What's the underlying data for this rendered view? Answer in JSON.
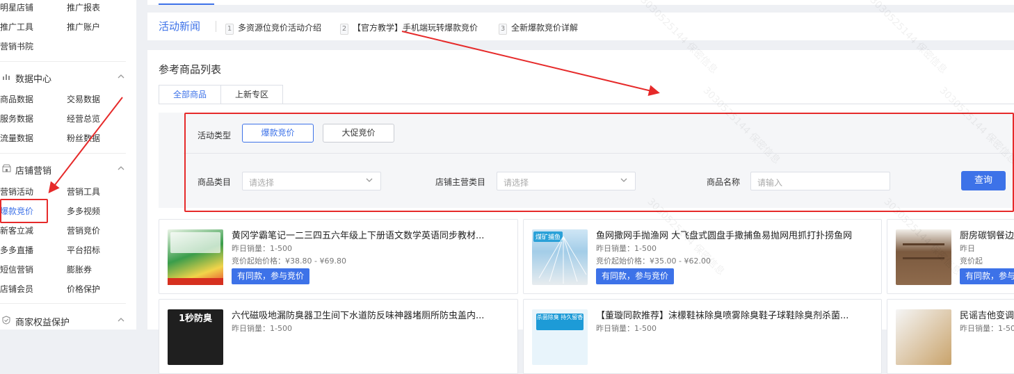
{
  "sidebar": {
    "top_links": [
      "明星店铺",
      "推广报表",
      "推广工具",
      "推广账户",
      "营销书院"
    ],
    "data_center": {
      "title": "数据中心",
      "links": [
        "商品数据",
        "交易数据",
        "服务数据",
        "经营总览",
        "流量数据",
        "粉丝数据"
      ]
    },
    "shop_marketing": {
      "title": "店铺营销",
      "links": [
        "营销活动",
        "营销工具",
        "爆款竞价",
        "多多视频",
        "新客立减",
        "营销竞价",
        "多多直播",
        "平台招标",
        "短信营销",
        "膨胀券",
        "店铺会员",
        "价格保护"
      ]
    },
    "merchant_rights": {
      "title": "商家权益保护"
    }
  },
  "news": {
    "label": "活动新闻",
    "items": [
      {
        "num": "1",
        "text": "多资源位竞价活动介绍"
      },
      {
        "num": "2",
        "text": "【官方教学】手机端玩转爆款竞价"
      },
      {
        "num": "3",
        "text": "全新爆款竞价详解"
      }
    ]
  },
  "panel": {
    "title": "参考商品列表",
    "tabs": [
      "全部商品",
      "上新专区"
    ],
    "filter": {
      "activity_type_label": "活动类型",
      "activity_options": [
        "爆款竞价",
        "大促竞价"
      ],
      "category_label": "商品类目",
      "category_placeholder": "请选择",
      "shop_category_label": "店铺主营类目",
      "shop_category_placeholder": "请选择",
      "name_label": "商品名称",
      "name_placeholder": "请输入",
      "query_button": "查询"
    }
  },
  "products": [
    {
      "title": "黄冈学霸笔记一二三四五六年级上下册语文数学英语同步教材...",
      "sales": "昨日销量：1-500",
      "price": "竞价起始价格：¥38.80 - ¥69.80",
      "button": "有同款，参与竞价"
    },
    {
      "title": "鱼网撒网手抛渔网 大飞盘式圆盘手撒捕鱼易抛网甩抓打扑捞鱼网",
      "sales": "昨日销量：1-500",
      "price": "竞价起始价格：¥35.00 - ¥62.00",
      "button": "有同款，参与竞价"
    },
    {
      "title": "厨房碳钢餐边",
      "sales": "昨日",
      "price": "竞价起",
      "button": "有同款，参与"
    },
    {
      "title": "六代磁吸地漏防臭器卫生间下水道防反味神器堵厕所防虫盖内...",
      "sales": "昨日销量：1-500"
    },
    {
      "title": "【董璇同款推荐】沫檬鞋袜除臭喷雾除臭鞋子球鞋除臭剂杀菌...",
      "sales": "昨日销量：1-500"
    },
    {
      "title": "民谣吉他变调",
      "sales": "昨日销量：1-50"
    }
  ],
  "thumb_labels": {
    "t4": "1秒防臭",
    "t2": "煤矿捕鱼",
    "t5": "杀菌除臭 持久留香"
  },
  "watermark": "3030525144 保密信息",
  "colors": {
    "accent": "#3d72e8",
    "highlight": "#e62a2a"
  }
}
